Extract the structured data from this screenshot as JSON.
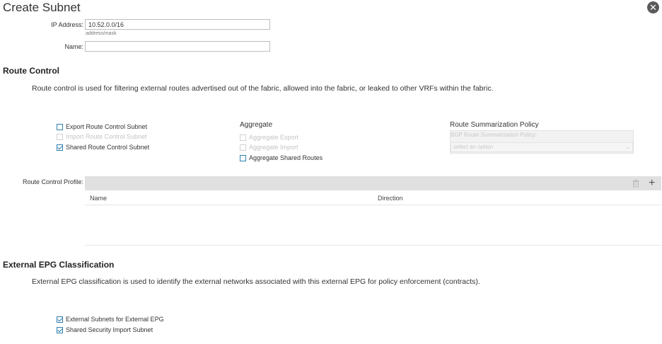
{
  "dialog": {
    "title": "Create Subnet",
    "close_icon": "close-icon"
  },
  "form": {
    "ip_address": {
      "label": "IP Address:",
      "value": "10.52.0.0/16",
      "hint": "address/mask"
    },
    "name": {
      "label": "Name:",
      "value": ""
    }
  },
  "route_control": {
    "title": "Route Control",
    "description": "Route control is used for filtering external routes advertised out of the fabric, allowed into the fabric, or leaked to other VRFs within the fabric.",
    "subnet_options": [
      {
        "label": "Export Route Control Subnet",
        "checked": false,
        "disabled": false
      },
      {
        "label": "Import Route Control Subnet",
        "checked": false,
        "disabled": true
      },
      {
        "label": "Shared Route Control Subnet",
        "checked": true,
        "disabled": false
      }
    ],
    "aggregate": {
      "title": "Aggregate",
      "options": [
        {
          "label": "Aggregate Export",
          "checked": false,
          "disabled": true
        },
        {
          "label": "Aggregate Import",
          "checked": false,
          "disabled": true
        },
        {
          "label": "Aggregate Shared Routes",
          "checked": false,
          "disabled": false
        }
      ]
    },
    "summarization": {
      "title": "Route Summarization Policy",
      "field_label": "BGP Route Summarization Policy:",
      "placeholder": "select an option"
    },
    "profile": {
      "label": "Route Control Profile:",
      "columns": [
        "Name",
        "Direction"
      ],
      "rows": [],
      "icons": {
        "delete": "trash-icon",
        "add": "plus-icon"
      }
    }
  },
  "epg": {
    "title": "External EPG Classification",
    "description": "External EPG classification is used to identify the external networks associated with this external EPG for policy enforcement (contracts).",
    "options": [
      {
        "label": "External Subnets for External EPG",
        "checked": true
      },
      {
        "label": "Shared Security Import Subnet",
        "checked": true
      }
    ]
  },
  "colors": {
    "accent": "#2f7fb0",
    "toolbar": "#e0e0e0",
    "text": "#333333"
  }
}
